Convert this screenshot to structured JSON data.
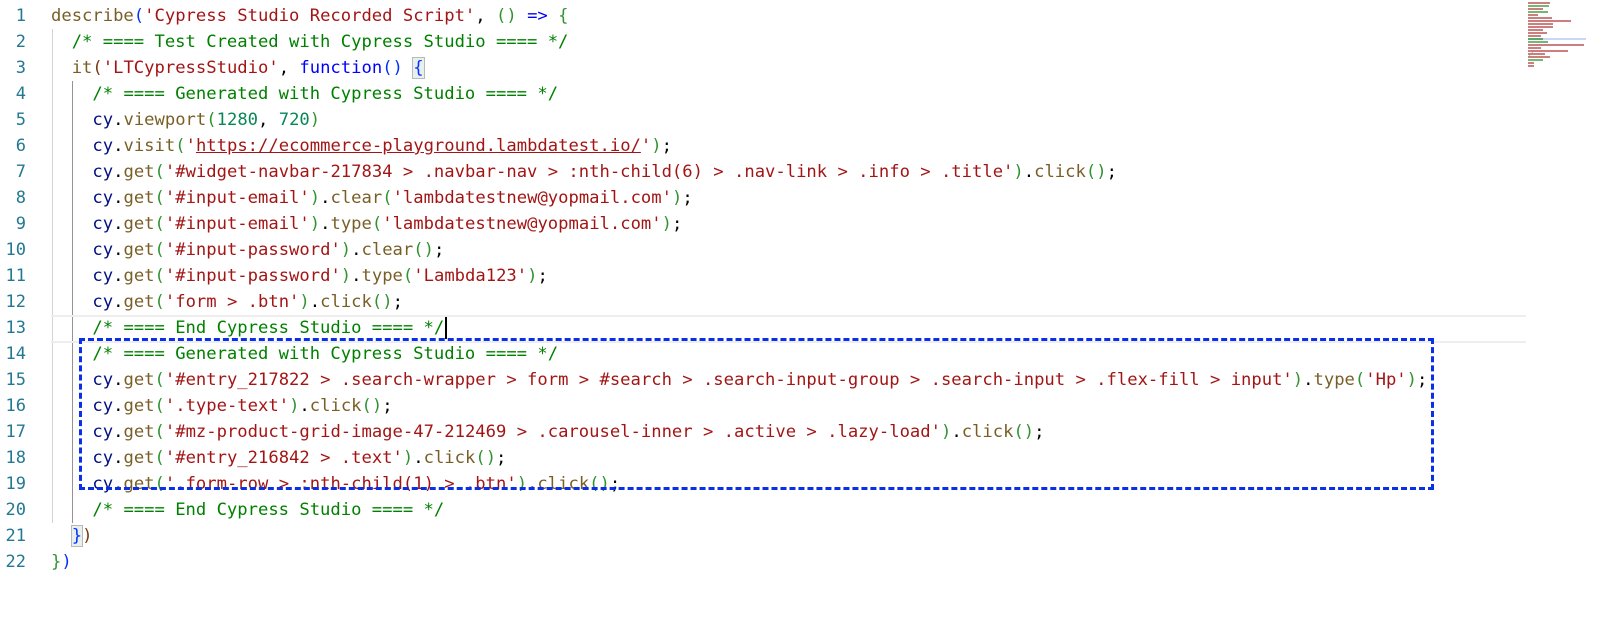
{
  "editor": {
    "language": "javascript",
    "current_line": 13,
    "line_numbers": [
      "1",
      "2",
      "3",
      "4",
      "5",
      "6",
      "7",
      "8",
      "9",
      "10",
      "11",
      "12",
      "13",
      "14",
      "15",
      "16",
      "17",
      "18",
      "19",
      "20",
      "21",
      "22"
    ],
    "lines": [
      {
        "n": 1,
        "text": "describe('Cypress Studio Recorded Script', () => {"
      },
      {
        "n": 2,
        "text": "/* ==== Test Created with Cypress Studio ==== */"
      },
      {
        "n": 3,
        "text": "it('LTCypressStudio', function() {"
      },
      {
        "n": 4,
        "text": "/* ==== Generated with Cypress Studio ==== */"
      },
      {
        "n": 5,
        "text": "cy.viewport(1280, 720)"
      },
      {
        "n": 6,
        "text": "cy.visit('https://ecommerce-playground.lambdatest.io/');"
      },
      {
        "n": 7,
        "text": "cy.get('#widget-navbar-217834 > .navbar-nav > :nth-child(6) > .nav-link > .info > .title').click();"
      },
      {
        "n": 8,
        "text": "cy.get('#input-email').clear('lambdatestnew@yopmail.com');"
      },
      {
        "n": 9,
        "text": "cy.get('#input-email').type('lambdatestnew@yopmail.com');"
      },
      {
        "n": 10,
        "text": "cy.get('#input-password').clear();"
      },
      {
        "n": 11,
        "text": "cy.get('#input-password').type('Lambda123');"
      },
      {
        "n": 12,
        "text": "cy.get('form > .btn').click();"
      },
      {
        "n": 13,
        "text": "/* ==== End Cypress Studio ==== */"
      },
      {
        "n": 14,
        "text": "/* ==== Generated with Cypress Studio ==== */"
      },
      {
        "n": 15,
        "text": "cy.get('#entry_217822 > .search-wrapper > form > #search > .search-input-group > .search-input > .flex-fill > input').type('Hp');"
      },
      {
        "n": 16,
        "text": "cy.get('.type-text').click();"
      },
      {
        "n": 17,
        "text": "cy.get('#mz-product-grid-image-47-212469 > .carousel-inner > .active > .lazy-load').click();"
      },
      {
        "n": 18,
        "text": "cy.get('#entry_216842 > .text').click();"
      },
      {
        "n": 19,
        "text": "cy.get('.form-row > :nth-child(1) > .btn').click();"
      },
      {
        "n": 20,
        "text": "/* ==== End Cypress Studio ==== */"
      },
      {
        "n": 21,
        "text": "})"
      },
      {
        "n": 22,
        "text": "})"
      }
    ],
    "tokens": {
      "describe": "describe",
      "describe_title": "'Cypress Studio Recorded Script'",
      "arrow": "=>",
      "comment_test_created": "/* ==== Test Created with Cypress Studio ==== */",
      "it": "it",
      "it_title": "'LTCypressStudio'",
      "function_kw": "function",
      "comment_generated": "/* ==== Generated with Cypress Studio ==== */",
      "comment_end": "/* ==== End Cypress Studio ==== */",
      "cy": "cy",
      "viewport": "viewport",
      "viewport_w": "1280",
      "viewport_h": "720",
      "visit": "visit",
      "visit_url": "https://ecommerce-playground.lambdatest.io/",
      "get": "get",
      "click": "click",
      "clear": "clear",
      "type": "type",
      "sel_navbar": "'#widget-navbar-217834 > .navbar-nav > :nth-child(6) > .nav-link > .info > .title'",
      "sel_email": "'#input-email'",
      "email_value": "'lambdatestnew@yopmail.com'",
      "sel_password": "'#input-password'",
      "password_value": "'Lambda123'",
      "sel_form_btn": "'form > .btn'",
      "sel_search": "'#entry_217822 > .search-wrapper > form > #search > .search-input-group > .search-input > .flex-fill > input'",
      "search_value": "'Hp'",
      "sel_type_text": "'.type-text'",
      "sel_product": "'#mz-product-grid-image-47-212469 > .carousel-inner > .active > .lazy-load'",
      "sel_entry_text": "'#entry_216842 > .text'",
      "sel_form_row": "'.form-row > :nth-child(1) > .btn'"
    },
    "highlight_box": {
      "from_line": 14,
      "to_line": 19,
      "color": "#0a2fe8",
      "style": "dashed"
    }
  },
  "colors": {
    "comment": "#008000",
    "string": "#a31515",
    "function": "#795e26",
    "variable": "#001080",
    "keyword": "#0000ff",
    "number": "#098658",
    "line_number": "#237893"
  }
}
